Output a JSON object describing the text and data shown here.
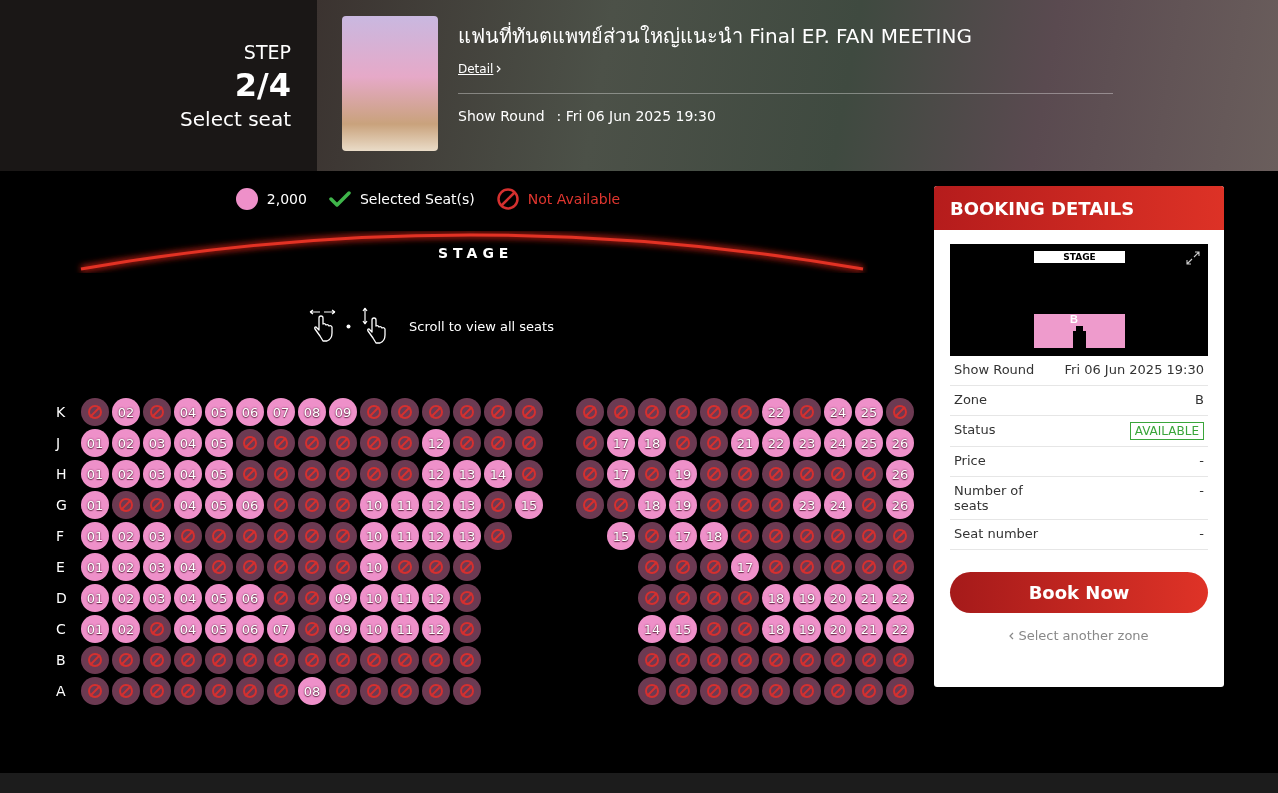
{
  "header": {
    "step_label": "STEP",
    "step": "2/4",
    "step_title": "Select seat",
    "title": "แฟนที่ทันตแพทย์ส่วนใหญ่แนะนำ Final EP. FAN MEETING",
    "detail_link": "Detail",
    "show_round_label": "Show Round",
    "show_round_value": ": Fri 06 Jun 2025 19:30"
  },
  "legend": [
    {
      "kind": "price",
      "label": "2,000"
    },
    {
      "kind": "selected",
      "label": "Selected Seat(s)"
    },
    {
      "kind": "unavailable",
      "label": "Not Available"
    }
  ],
  "stage_label": "STAGE",
  "scroll_hint": "Scroll to view all seats",
  "rows": [
    {
      "row": "K",
      "left": [
        {
          "available": false
        },
        {
          "label": "02",
          "available": true
        },
        {
          "available": false
        },
        {
          "label": "04",
          "available": true
        },
        {
          "label": "05",
          "available": true
        },
        {
          "label": "06",
          "available": true
        },
        {
          "label": "07",
          "available": true
        },
        {
          "label": "08",
          "available": true
        },
        {
          "label": "09",
          "available": true
        },
        {
          "available": false
        },
        {
          "available": false
        },
        {
          "available": false
        },
        {
          "available": false
        },
        {
          "available": false
        },
        {
          "available": false
        }
      ],
      "right": [
        {
          "available": false
        },
        {
          "available": false
        },
        {
          "available": false
        },
        {
          "available": false
        },
        {
          "available": false
        },
        {
          "available": false
        },
        {
          "label": "22",
          "available": true
        },
        {
          "available": false
        },
        {
          "label": "24",
          "available": true
        },
        {
          "label": "25",
          "available": true
        },
        {
          "available": false
        }
      ]
    },
    {
      "row": "J",
      "left": [
        {
          "label": "01",
          "available": true
        },
        {
          "label": "02",
          "available": true
        },
        {
          "label": "03",
          "available": true
        },
        {
          "label": "04",
          "available": true
        },
        {
          "label": "05",
          "available": true
        },
        {
          "available": false
        },
        {
          "available": false
        },
        {
          "available": false
        },
        {
          "available": false
        },
        {
          "available": false
        },
        {
          "available": false
        },
        {
          "label": "12",
          "available": true
        },
        {
          "available": false
        },
        {
          "available": false
        },
        {
          "available": false
        }
      ],
      "right": [
        {
          "available": false
        },
        {
          "label": "17",
          "available": true
        },
        {
          "label": "18",
          "available": true
        },
        {
          "available": false
        },
        {
          "available": false
        },
        {
          "label": "21",
          "available": true
        },
        {
          "label": "22",
          "available": true
        },
        {
          "label": "23",
          "available": true
        },
        {
          "label": "24",
          "available": true
        },
        {
          "label": "25",
          "available": true
        },
        {
          "label": "26",
          "available": true
        }
      ]
    },
    {
      "row": "H",
      "left": [
        {
          "label": "01",
          "available": true
        },
        {
          "label": "02",
          "available": true
        },
        {
          "label": "03",
          "available": true
        },
        {
          "label": "04",
          "available": true
        },
        {
          "label": "05",
          "available": true
        },
        {
          "available": false
        },
        {
          "available": false
        },
        {
          "available": false
        },
        {
          "available": false
        },
        {
          "available": false
        },
        {
          "available": false
        },
        {
          "label": "12",
          "available": true
        },
        {
          "label": "13",
          "available": true
        },
        {
          "label": "14",
          "available": true
        },
        {
          "available": false
        }
      ],
      "right": [
        {
          "available": false
        },
        {
          "label": "17",
          "available": true
        },
        {
          "available": false
        },
        {
          "label": "19",
          "available": true
        },
        {
          "available": false
        },
        {
          "available": false
        },
        {
          "available": false
        },
        {
          "available": false
        },
        {
          "available": false
        },
        {
          "available": false
        },
        {
          "label": "26",
          "available": true
        }
      ]
    },
    {
      "row": "G",
      "left": [
        {
          "label": "01",
          "available": true
        },
        {
          "available": false
        },
        {
          "available": false
        },
        {
          "label": "04",
          "available": true
        },
        {
          "label": "05",
          "available": true
        },
        {
          "label": "06",
          "available": true
        },
        {
          "available": false
        },
        {
          "available": false
        },
        {
          "available": false
        },
        {
          "label": "10",
          "available": true
        },
        {
          "label": "11",
          "available": true
        },
        {
          "label": "12",
          "available": true
        },
        {
          "label": "13",
          "available": true
        },
        {
          "available": false
        },
        {
          "label": "15",
          "available": true
        }
      ],
      "right": [
        {
          "available": false
        },
        {
          "available": false
        },
        {
          "label": "18",
          "available": true
        },
        {
          "label": "19",
          "available": true
        },
        {
          "available": false
        },
        {
          "available": false
        },
        {
          "available": false
        },
        {
          "label": "23",
          "available": true
        },
        {
          "label": "24",
          "available": true
        },
        {
          "available": false
        },
        {
          "label": "26",
          "available": true
        }
      ]
    },
    {
      "row": "F",
      "left": [
        {
          "label": "01",
          "available": true
        },
        {
          "label": "02",
          "available": true
        },
        {
          "label": "03",
          "available": true
        },
        {
          "available": false
        },
        {
          "available": false
        },
        {
          "available": false
        },
        {
          "available": false
        },
        {
          "available": false
        },
        {
          "available": false
        },
        {
          "label": "10",
          "available": true
        },
        {
          "label": "11",
          "available": true
        },
        {
          "label": "12",
          "available": true
        },
        {
          "label": "13",
          "available": true
        },
        {
          "available": false
        }
      ],
      "right": [
        {
          "label": "15",
          "available": true
        },
        {
          "available": false
        },
        {
          "label": "17",
          "available": true
        },
        {
          "label": "18",
          "available": true
        },
        {
          "available": false
        },
        {
          "available": false
        },
        {
          "available": false
        },
        {
          "available": false
        },
        {
          "available": false
        },
        {
          "available": false
        }
      ]
    },
    {
      "row": "E",
      "left": [
        {
          "label": "01",
          "available": true
        },
        {
          "label": "02",
          "available": true
        },
        {
          "label": "03",
          "available": true
        },
        {
          "label": "04",
          "available": true
        },
        {
          "available": false
        },
        {
          "available": false
        },
        {
          "available": false
        },
        {
          "available": false
        },
        {
          "available": false
        },
        {
          "label": "10",
          "available": true
        },
        {
          "available": false
        },
        {
          "available": false
        },
        {
          "available": false
        }
      ],
      "right": [
        {
          "available": false
        },
        {
          "available": false
        },
        {
          "available": false
        },
        {
          "label": "17",
          "available": true
        },
        {
          "available": false
        },
        {
          "available": false
        },
        {
          "available": false
        },
        {
          "available": false
        },
        {
          "available": false
        }
      ]
    },
    {
      "row": "D",
      "left": [
        {
          "label": "01",
          "available": true
        },
        {
          "label": "02",
          "available": true
        },
        {
          "label": "03",
          "available": true
        },
        {
          "label": "04",
          "available": true
        },
        {
          "label": "05",
          "available": true
        },
        {
          "label": "06",
          "available": true
        },
        {
          "available": false
        },
        {
          "available": false
        },
        {
          "label": "09",
          "available": true
        },
        {
          "label": "10",
          "available": true
        },
        {
          "label": "11",
          "available": true
        },
        {
          "label": "12",
          "available": true
        },
        {
          "available": false
        }
      ],
      "right": [
        {
          "available": false
        },
        {
          "available": false
        },
        {
          "available": false
        },
        {
          "available": false
        },
        {
          "label": "18",
          "available": true
        },
        {
          "label": "19",
          "available": true
        },
        {
          "label": "20",
          "available": true
        },
        {
          "label": "21",
          "available": true
        },
        {
          "label": "22",
          "available": true
        }
      ]
    },
    {
      "row": "C",
      "left": [
        {
          "label": "01",
          "available": true
        },
        {
          "label": "02",
          "available": true
        },
        {
          "available": false
        },
        {
          "label": "04",
          "available": true
        },
        {
          "label": "05",
          "available": true
        },
        {
          "label": "06",
          "available": true
        },
        {
          "label": "07",
          "available": true
        },
        {
          "available": false
        },
        {
          "label": "09",
          "available": true
        },
        {
          "label": "10",
          "available": true
        },
        {
          "label": "11",
          "available": true
        },
        {
          "label": "12",
          "available": true
        },
        {
          "available": false
        }
      ],
      "right": [
        {
          "label": "14",
          "available": true
        },
        {
          "label": "15",
          "available": true
        },
        {
          "available": false
        },
        {
          "available": false
        },
        {
          "label": "18",
          "available": true
        },
        {
          "label": "19",
          "available": true
        },
        {
          "label": "20",
          "available": true
        },
        {
          "label": "21",
          "available": true
        },
        {
          "label": "22",
          "available": true
        }
      ]
    },
    {
      "row": "B",
      "left": [
        {
          "available": false
        },
        {
          "available": false
        },
        {
          "available": false
        },
        {
          "available": false
        },
        {
          "available": false
        },
        {
          "available": false
        },
        {
          "available": false
        },
        {
          "available": false
        },
        {
          "available": false
        },
        {
          "available": false
        },
        {
          "available": false
        },
        {
          "available": false
        },
        {
          "available": false
        }
      ],
      "right": [
        {
          "available": false
        },
        {
          "available": false
        },
        {
          "available": false
        },
        {
          "available": false
        },
        {
          "available": false
        },
        {
          "available": false
        },
        {
          "available": false
        },
        {
          "available": false
        },
        {
          "available": false
        }
      ]
    },
    {
      "row": "A",
      "left": [
        {
          "available": false
        },
        {
          "available": false
        },
        {
          "available": false
        },
        {
          "available": false
        },
        {
          "available": false
        },
        {
          "available": false
        },
        {
          "available": false
        },
        {
          "label": "08",
          "available": true
        },
        {
          "available": false
        },
        {
          "available": false
        },
        {
          "available": false
        },
        {
          "available": false
        },
        {
          "available": false
        }
      ],
      "right": [
        {
          "available": false
        },
        {
          "available": false
        },
        {
          "available": false
        },
        {
          "available": false
        },
        {
          "available": false
        },
        {
          "available": false
        },
        {
          "available": false
        },
        {
          "available": false
        },
        {
          "available": false
        }
      ]
    }
  ],
  "booking": {
    "title": "BOOKING DETAILS",
    "minimap": {
      "stage_label": "STAGE",
      "zone_label": "B"
    },
    "details": [
      {
        "kind": "text",
        "label": "Show Round",
        "value": "Fri 06 Jun 2025 19:30"
      },
      {
        "kind": "text",
        "label": "Zone",
        "value": "B"
      },
      {
        "kind": "status",
        "label": "Status",
        "value": "AVAILABLE"
      },
      {
        "kind": "text",
        "label": "Price",
        "value": "-"
      },
      {
        "kind": "text",
        "label": "Number of seats",
        "value": "-"
      },
      {
        "kind": "text",
        "label": "Seat number",
        "value": "-"
      }
    ],
    "button": "Book Now",
    "back_link": "Select another zone"
  }
}
